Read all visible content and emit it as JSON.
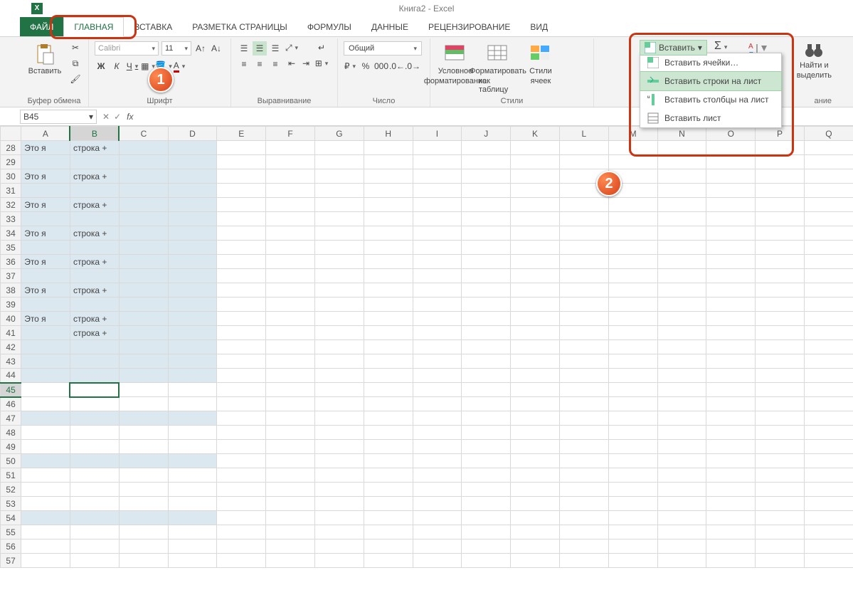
{
  "title": "Книга2 - Excel",
  "tabs": {
    "file": "ФАЙЛ",
    "list": [
      "ГЛАВНАЯ",
      "ВСТАВКА",
      "РАЗМЕТКА СТРАНИЦЫ",
      "ФОРМУЛЫ",
      "ДАННЫЕ",
      "РЕЦЕНЗИРОВАНИЕ",
      "ВИД"
    ],
    "active_index": 0
  },
  "ribbon": {
    "clipboard": {
      "paste": "Вставить",
      "group": "Буфер обмена"
    },
    "font": {
      "name": "Calibri",
      "size": "11",
      "group": "Шрифт",
      "bold": "Ж",
      "italic": "К",
      "underline": "Ч"
    },
    "alignment": {
      "group": "Выравнивание"
    },
    "number": {
      "format": "Общий",
      "group": "Число"
    },
    "styles": {
      "cond": "Условное",
      "cond2": "форматирование",
      "fmt": "Форматировать",
      "fmt2": "как таблицу",
      "cell": "Стили",
      "cell2": "ячеек",
      "group": "Стили"
    },
    "cells": {
      "insert": "Вставить"
    },
    "editing": {
      "find": "Найти и",
      "select": "выделить",
      "group": "ание"
    }
  },
  "insert_menu": {
    "cells": "Вставить ячейки…",
    "rows": "Вставить строки на лист",
    "cols": "Вставить столбцы на лист",
    "sheet": "Вставить лист"
  },
  "name_box": "B45",
  "columns": [
    "A",
    "B",
    "C",
    "D",
    "E",
    "F",
    "G",
    "H",
    "I",
    "J",
    "K",
    "L",
    "M",
    "N",
    "O",
    "P",
    "Q"
  ],
  "active_col_index": 1,
  "rows": {
    "start": 28,
    "end": 57,
    "active": 45,
    "colA_text": "Это я",
    "colB_text": "строка +",
    "data_rows": [
      28,
      30,
      32,
      34,
      36,
      38,
      40
    ],
    "extra_b_row": 41,
    "selected_rows": [
      28,
      29,
      30,
      31,
      32,
      33,
      34,
      35,
      36,
      37,
      38,
      39,
      40,
      41,
      42,
      43
    ],
    "selected_single_rows": [
      44,
      47,
      50,
      54
    ],
    "selected_cols_abcd": true
  },
  "badges": {
    "one": "1",
    "two": "2"
  }
}
